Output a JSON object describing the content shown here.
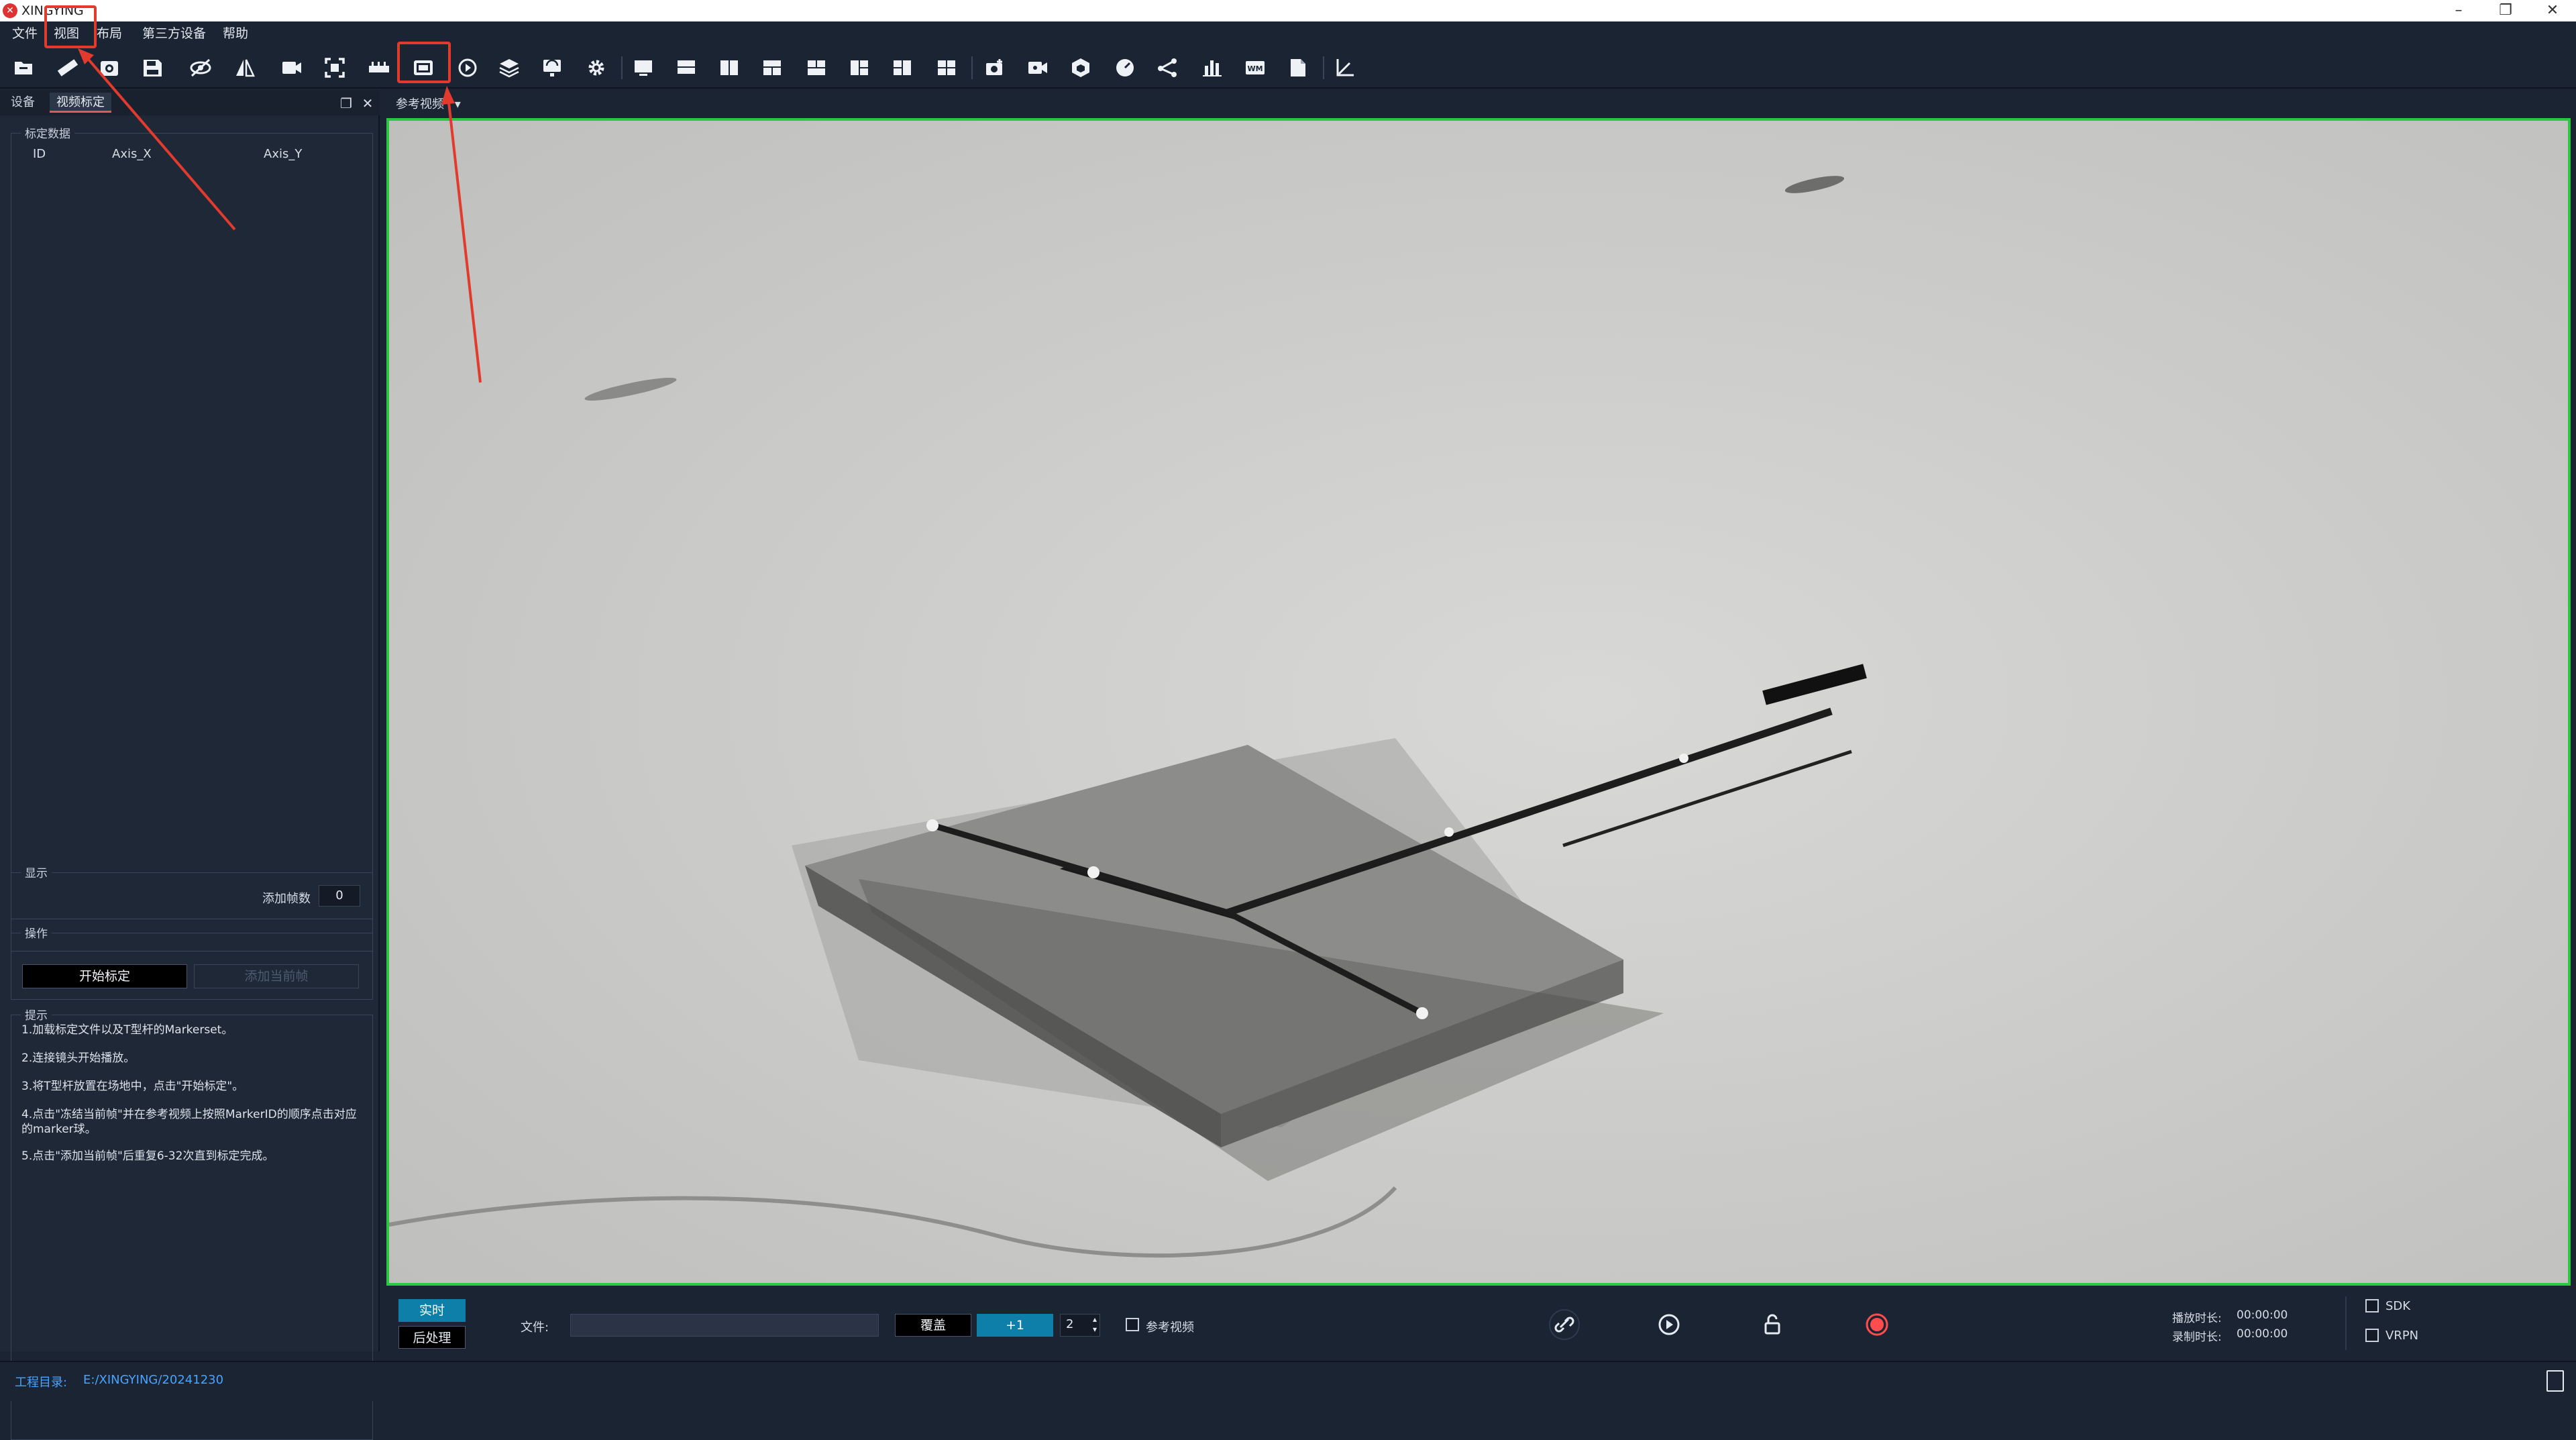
{
  "window": {
    "title": "XINGYING",
    "minimize": "–",
    "maximize": "❐",
    "close": "✕"
  },
  "menu": [
    "文件",
    "视图",
    "布局",
    "第三方设备",
    "帮助"
  ],
  "toolbar": {
    "icons": [
      "open-folder-icon",
      "ruler-icon",
      "calibrate-camera-icon",
      "save-icon",
      "hide-icon",
      "mirror-icon",
      "video-camera-icon",
      "fullscreen-icon",
      "ruler-bar-icon",
      "video-calibration-icon",
      "replay-icon",
      "layers-icon",
      "network-icon",
      "settings-icon",
      "layout-1-icon",
      "layout-2-icon",
      "layout-3-icon",
      "layout-4-icon",
      "layout-5-icon",
      "layout-6-icon",
      "layout-7-icon",
      "layout-8-icon",
      "camera-add-icon",
      "camera-record-icon",
      "cube-icon",
      "speedometer-icon",
      "skeleton-icon",
      "bar-chart-icon",
      "wm-icon",
      "document-icon",
      "axis-icon"
    ]
  },
  "left_panel": {
    "tabs": [
      "设备",
      "视频标定"
    ],
    "active_tab": 1,
    "calibration": {
      "title": "标定数据",
      "columns": [
        "ID",
        "Axis_X",
        "Axis_Y"
      ]
    },
    "display": {
      "title": "显示",
      "frames_label": "添加帧数",
      "frames_value": "0"
    },
    "operation": {
      "title": "操作",
      "start_button": "开始标定",
      "add_frame_button": "添加当前帧"
    },
    "tips": {
      "title": "提示",
      "items": [
        "1.加载标定文件以及T型杆的Markerset。",
        "2.连接镜头开始播放。",
        "3.将T型杆放置在场地中，点击\"开始标定\"。",
        "4.点击\"冻结当前帧\"并在参考视频上按照MarkerID的顺序点击对应的marker球。",
        "5.点击\"添加当前帧\"后重复6-32次直到标定完成。"
      ]
    }
  },
  "video": {
    "source_label": "参考视频",
    "frame_color": "#28c840"
  },
  "controls": {
    "realtime_button": "实时",
    "postprocess_button": "后处理",
    "file_label": "文件:",
    "file_value": "",
    "overwrite_button": "覆盖",
    "increment_button": "+1",
    "spin_value": "2",
    "ref_video_label": "参考视频",
    "play_time_label": "播放时长:",
    "play_time_value": "00:00:00",
    "record_time_label": "录制时长:",
    "record_time_value": "00:00:00",
    "sdk_label": "SDK",
    "vrpn_label": "VRPN"
  },
  "status": {
    "project_dir_label": "工程目录:",
    "project_dir_value": "E:/XINGYING/20241230"
  },
  "colors": {
    "accent": "#0e7fa8",
    "annotation": "#e23b2e",
    "record": "#ff4d4d"
  }
}
